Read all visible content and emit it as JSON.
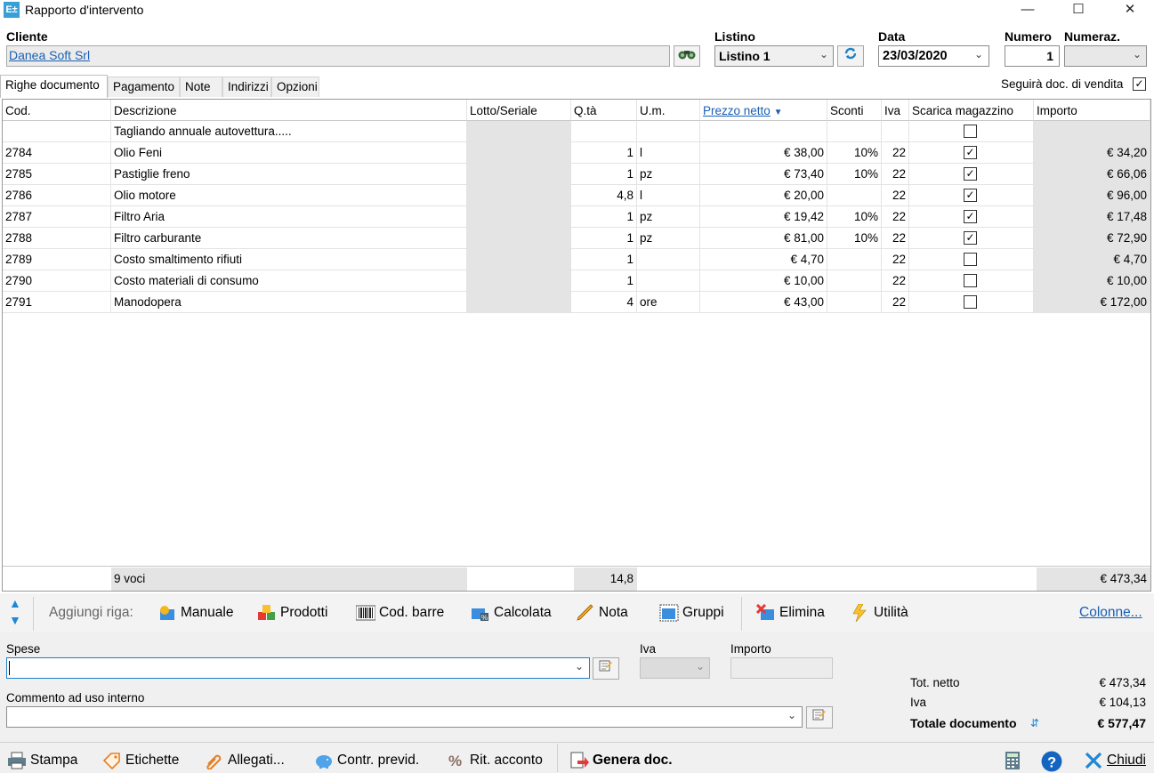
{
  "window": {
    "title": "Rapporto d'intervento",
    "icon_text": "E±",
    "minimize": "—",
    "maximize": "☐",
    "close": "✕"
  },
  "header": {
    "cliente_label": "Cliente",
    "cliente_value": "Danea Soft Srl",
    "listino_label": "Listino",
    "listino_value": "Listino 1",
    "data_label": "Data",
    "data_value": "23/03/2020",
    "numero_label": "Numero",
    "numero_value": "1",
    "numeraz_label": "Numeraz.",
    "numeraz_value": ""
  },
  "tabs": [
    "Righe documento",
    "Pagamento",
    "Note",
    "Indirizzi",
    "Opzioni"
  ],
  "seguira": {
    "label": "Seguirà doc. di vendita",
    "checked": true
  },
  "columns": [
    "Cod.",
    "Descrizione",
    "Lotto/Seriale",
    "Q.tà",
    "U.m.",
    "Prezzo netto",
    "Sconti",
    "Iva",
    "Scarica magazzino",
    "Importo"
  ],
  "rows": [
    {
      "cod": "",
      "descr": "Tagliando annuale autovettura.....",
      "lotto": "",
      "qta": "",
      "um": "",
      "prezzo": "",
      "sconti": "",
      "iva": "",
      "scarica": false,
      "importo": ""
    },
    {
      "cod": "2784",
      "descr": "Olio Feni",
      "lotto": "",
      "qta": "1",
      "um": "l",
      "prezzo": "€ 38,00",
      "sconti": "10%",
      "iva": "22",
      "scarica": true,
      "importo": "€ 34,20"
    },
    {
      "cod": "2785",
      "descr": "Pastiglie freno",
      "lotto": "",
      "qta": "1",
      "um": "pz",
      "prezzo": "€ 73,40",
      "sconti": "10%",
      "iva": "22",
      "scarica": true,
      "importo": "€ 66,06"
    },
    {
      "cod": "2786",
      "descr": "Olio motore",
      "lotto": "",
      "qta": "4,8",
      "um": "l",
      "prezzo": "€ 20,00",
      "sconti": "",
      "iva": "22",
      "scarica": true,
      "importo": "€ 96,00"
    },
    {
      "cod": "2787",
      "descr": "Filtro Aria",
      "lotto": "",
      "qta": "1",
      "um": "pz",
      "prezzo": "€ 19,42",
      "sconti": "10%",
      "iva": "22",
      "scarica": true,
      "importo": "€ 17,48"
    },
    {
      "cod": "2788",
      "descr": "Filtro carburante",
      "lotto": "",
      "qta": "1",
      "um": "pz",
      "prezzo": "€ 81,00",
      "sconti": "10%",
      "iva": "22",
      "scarica": true,
      "importo": "€ 72,90"
    },
    {
      "cod": "2789",
      "descr": "Costo smaltimento rifiuti",
      "lotto": "",
      "qta": "1",
      "um": "",
      "prezzo": "€ 4,70",
      "sconti": "",
      "iva": "22",
      "scarica": false,
      "importo": "€ 4,70"
    },
    {
      "cod": "2790",
      "descr": "Costo materiali di consumo",
      "lotto": "",
      "qta": "1",
      "um": "",
      "prezzo": "€ 10,00",
      "sconti": "",
      "iva": "22",
      "scarica": false,
      "importo": "€ 10,00"
    },
    {
      "cod": "2791",
      "descr": "Manodopera",
      "lotto": "",
      "qta": "4",
      "um": "ore",
      "prezzo": "€ 43,00",
      "sconti": "",
      "iva": "22",
      "scarica": false,
      "importo": "€ 172,00"
    }
  ],
  "totals_row": {
    "voci": "9 voci",
    "qta": "14,8",
    "importo": "€ 473,34"
  },
  "toolbar": {
    "aggiungi_label": "Aggiungi riga:",
    "manuale": "Manuale",
    "prodotti": "Prodotti",
    "cod_barre": "Cod. barre",
    "calcolata": "Calcolata",
    "nota": "Nota",
    "gruppi": "Gruppi",
    "elimina": "Elimina",
    "utilita": "Utilità",
    "colonne": "Colonne..."
  },
  "bottom": {
    "spese_label": "Spese",
    "spese_value": "",
    "iva_label": "Iva",
    "importo_label": "Importo",
    "commento_label": "Commento ad uso interno",
    "commento_value": ""
  },
  "summary": {
    "tot_netto_label": "Tot. netto",
    "tot_netto": "€ 473,34",
    "iva_label": "Iva",
    "iva": "€ 104,13",
    "totale_label": "Totale documento",
    "totale": "€ 577,47"
  },
  "statusbar": {
    "stampa": "Stampa",
    "etichette": "Etichette",
    "allegati": "Allegati...",
    "contr_previd": "Contr. previd.",
    "rit_acconto": "Rit. acconto",
    "genera_doc": "Genera doc.",
    "chiudi": "Chiudi"
  },
  "colors": {
    "link": "#1a5fb4",
    "grey_cell": "#e4e4e4",
    "toolbar_bg": "#f3f3f3"
  }
}
